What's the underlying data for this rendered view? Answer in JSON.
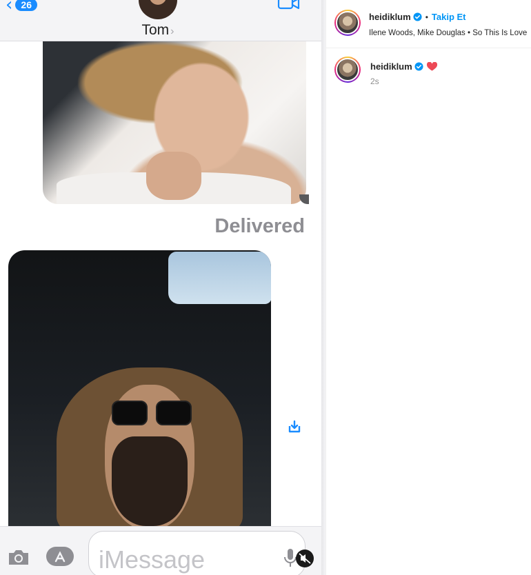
{
  "messages": {
    "back_count": "26",
    "contact_name": "Tom",
    "contact_chevron": "›",
    "status": "Delivered",
    "input_placeholder": "iMessage"
  },
  "instagram": {
    "username": "heidiklum",
    "follow_label": "Takip Et",
    "separator": "•",
    "audio": "Ilene Woods, Mike Douglas • So This Is Love",
    "comment_user": "heidiklum",
    "comment_time": "2s"
  },
  "colors": {
    "imessage_blue": "#1a8cff",
    "instagram_blue": "#0095f6",
    "heart_red": "#ed4956"
  },
  "icons": {
    "back": "chevron-left-icon",
    "video_call": "video-camera-icon",
    "save": "save-download-icon",
    "camera": "camera-icon",
    "appstore": "app-store-icon",
    "mic": "microphone-icon",
    "mute": "speaker-muted-icon",
    "verified": "verified-badge-icon",
    "heart": "heart-icon"
  }
}
